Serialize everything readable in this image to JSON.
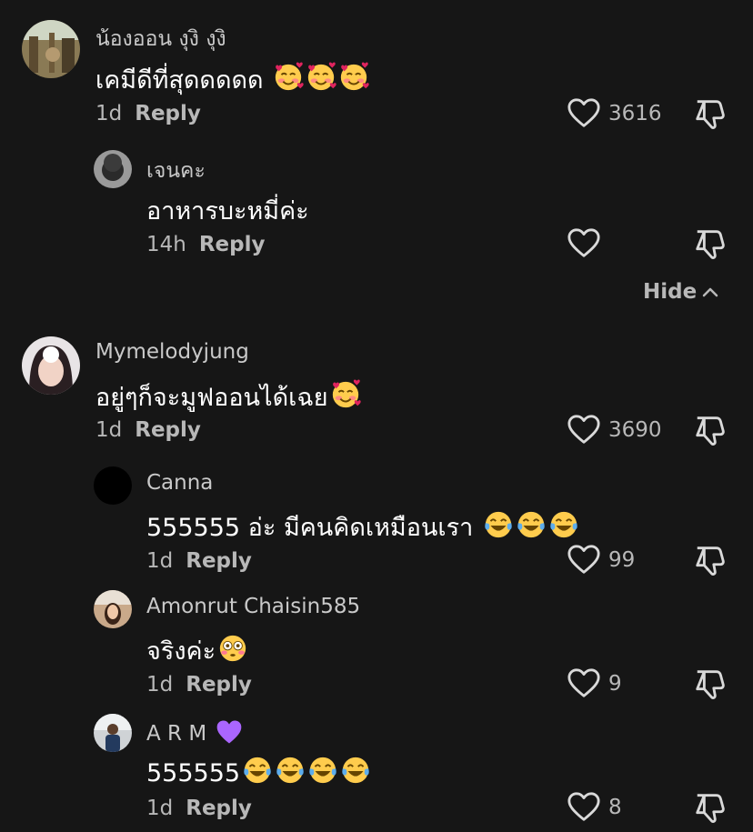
{
  "comments": [
    {
      "author": "น้องออน งุงิ งุงิ",
      "text": "เคมีดีที่สุดดดดด",
      "emoji": "🥰🥰🥰",
      "age": "1d",
      "reply_label": "Reply",
      "likes": "3616",
      "replies": [
        {
          "author": "เจนคะ",
          "text": "อาหารบะหมี่ค่ะ",
          "age": "14h",
          "reply_label": "Reply",
          "likes": ""
        }
      ],
      "hide_label": "Hide"
    },
    {
      "author": "Mymelodyjung",
      "text": "อยู่ๆก็จะมูฟออนได้เฉย",
      "emoji": "🥰",
      "age": "1d",
      "reply_label": "Reply",
      "likes": "3690",
      "replies": [
        {
          "author": "Canna",
          "text": "555555 อ่ะ มีคนคิดเหมือนเรา ",
          "emoji": "😂😂😂",
          "age": "1d",
          "reply_label": "Reply",
          "likes": "99"
        },
        {
          "author": "Amonrut Chaisin585",
          "text": "จริงค่ะ",
          "emoji": "😳",
          "age": "1d",
          "reply_label": "Reply",
          "likes": "9"
        },
        {
          "author": "A R M",
          "author_emoji": "💜",
          "text": "555555",
          "emoji": "😂😂😂😂",
          "age": "1d",
          "reply_label": "Reply",
          "likes": "8"
        }
      ]
    }
  ],
  "colors": {
    "background": "#161616",
    "author": "#c9c9c9",
    "text": "#ffffff",
    "muted": "#b8b8b8"
  },
  "icons": {
    "like": "heart-outline-icon",
    "dislike": "thumbs-down-outline-icon",
    "hide": "chevron-up-icon"
  }
}
